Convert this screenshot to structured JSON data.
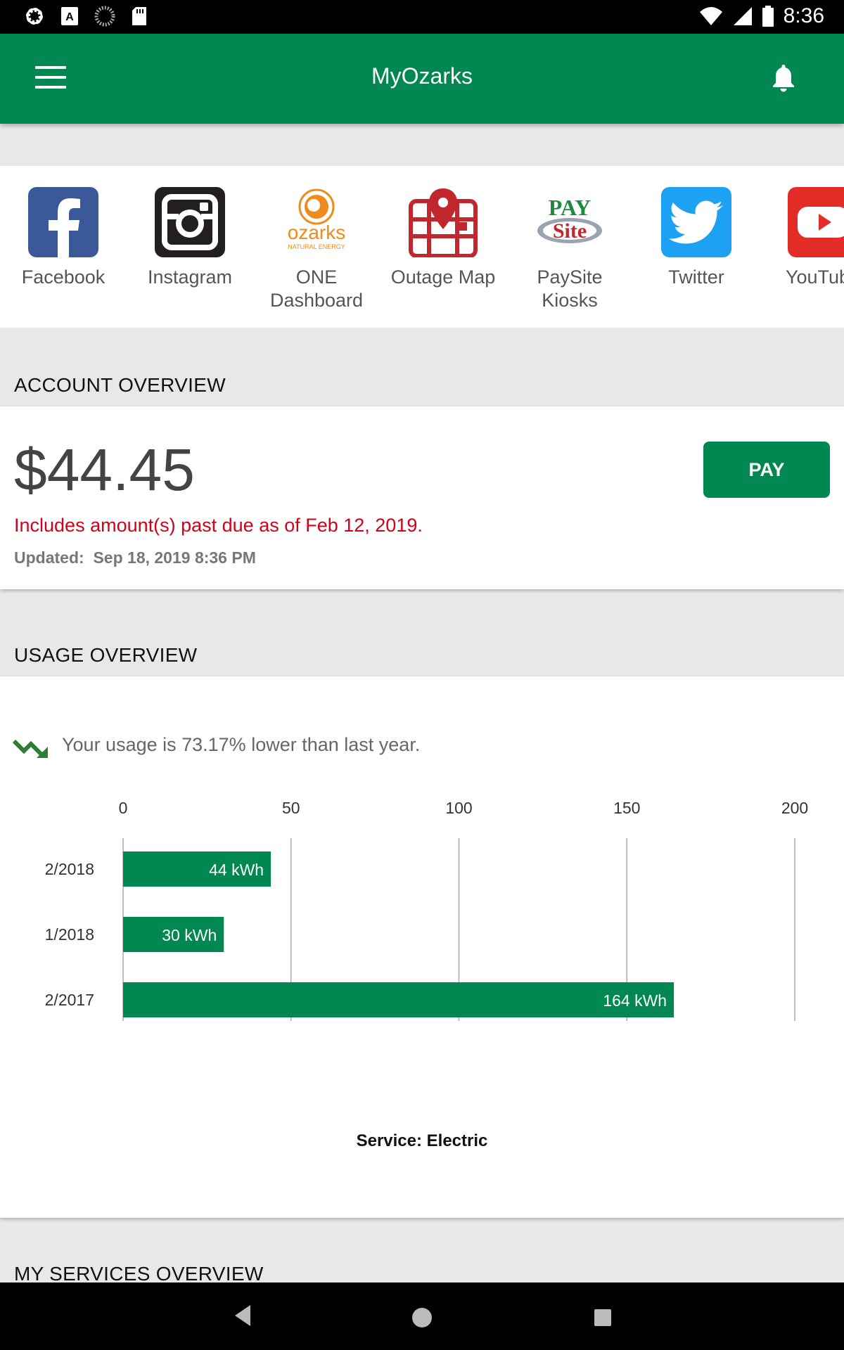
{
  "status_bar": {
    "time": "8:36"
  },
  "app_bar": {
    "title": "MyOzarks"
  },
  "quick_links": [
    {
      "label": "Facebook",
      "icon": "facebook-icon"
    },
    {
      "label": "Instagram",
      "icon": "instagram-icon"
    },
    {
      "label": "ONE\nDashboard",
      "icon": "ozarks-logo-icon",
      "logo_text": "ozarks",
      "logo_subtext": "NATURAL ENERGY"
    },
    {
      "label": "Outage Map",
      "icon": "outage-map-icon"
    },
    {
      "label": "PaySite\nKiosks",
      "icon": "paysite-logo-icon",
      "logo_text_top": "PAY",
      "logo_text_bottom": "Site"
    },
    {
      "label": "Twitter",
      "icon": "twitter-icon"
    },
    {
      "label": "YouTube",
      "icon": "youtube-icon"
    }
  ],
  "account_overview": {
    "header": "ACCOUNT OVERVIEW",
    "amount": "$44.45",
    "pay_label": "PAY",
    "past_due": "Includes amount(s) past due as of Feb 12, 2019.",
    "updated_label": "Updated:",
    "updated_value": "Sep 18, 2019 8:36 PM"
  },
  "usage_overview": {
    "header": "USAGE OVERVIEW",
    "trend_text": "Your usage is 73.17% lower than last year.",
    "service_label": "Service: Electric"
  },
  "chart_data": {
    "type": "bar",
    "orientation": "horizontal",
    "categories": [
      "2/2018",
      "1/2018",
      "2/2017"
    ],
    "values": [
      44,
      30,
      164
    ],
    "value_labels": [
      "44 kWh",
      "30 kWh",
      "164 kWh"
    ],
    "xlim": [
      0,
      200
    ],
    "x_ticks": [
      0,
      50,
      100,
      150,
      200
    ],
    "grid": true,
    "color": "#008752"
  },
  "my_services": {
    "header": "MY SERVICES OVERVIEW"
  },
  "colors": {
    "brand_green": "#008752",
    "alert_red": "#d0021b"
  }
}
